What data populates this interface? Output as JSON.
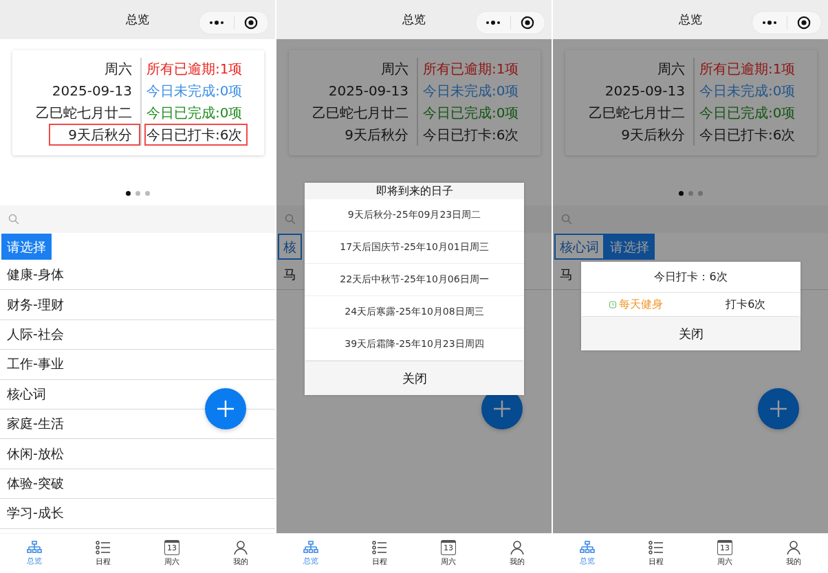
{
  "screens": [
    {
      "nav_title": "总览",
      "dimmed": false,
      "summary": {
        "left": [
          {
            "text": "周六",
            "highlighted": false
          },
          {
            "text": "2025-09-13",
            "highlighted": false
          },
          {
            "text": "乙巳蛇七月廿二",
            "highlighted": false
          },
          {
            "text": "9天后秋分",
            "highlighted": true
          }
        ],
        "right": [
          {
            "text": "所有已逾期:1项",
            "color": "#e8231e",
            "highlighted": false
          },
          {
            "text": "今日未完成:0项",
            "color": "#3a8ee6",
            "highlighted": false
          },
          {
            "text": "今日已完成:0项",
            "color": "#1e8c1e",
            "highlighted": false
          },
          {
            "text": "今日已打卡:6次",
            "color": "#222222",
            "highlighted": true
          }
        ]
      },
      "pager": [
        {
          "selected": true
        },
        {
          "selected": false
        },
        {
          "selected": false
        }
      ],
      "chips": [
        {
          "label": "请选择",
          "selected": true
        }
      ],
      "list": [
        "健康-身体",
        "财务-理财",
        "人际-社会",
        "工作-事业",
        "核心词",
        "家庭-生活",
        "休闲-放松",
        "体验-突破",
        "学习-成长"
      ],
      "tabs": [
        {
          "kind": "tree",
          "label": "总览",
          "selected": true
        },
        {
          "kind": "list",
          "label": "日程",
          "selected": false
        },
        {
          "kind": "calendar",
          "label": "周六",
          "day": "13",
          "selected": false
        },
        {
          "kind": "person",
          "label": "我的",
          "selected": false
        }
      ]
    },
    {
      "nav_title": "总览",
      "dimmed": true,
      "summary": {
        "left": [
          {
            "text": "周六",
            "highlighted": false
          },
          {
            "text": "2025-09-13",
            "highlighted": false
          },
          {
            "text": "乙巳蛇七月廿二",
            "highlighted": false
          },
          {
            "text": "9天后秋分",
            "highlighted": false
          }
        ],
        "right": [
          {
            "text": "所有已逾期:1项",
            "color": "#8b1512",
            "highlighted": false
          },
          {
            "text": "今日未完成:0项",
            "color": "#23558a",
            "highlighted": false
          },
          {
            "text": "今日已完成:0项",
            "color": "#125412",
            "highlighted": false
          },
          {
            "text": "今日已打卡:6次",
            "color": "#141414",
            "highlighted": false
          }
        ]
      },
      "chips": [
        {
          "label": "核",
          "selected": false
        }
      ],
      "list": [
        "马"
      ],
      "dialog": {
        "kind": "upcoming",
        "title": "即将到来的日子",
        "items": [
          "9天后秋分-25年09月23日周二",
          "17天后国庆节-25年10月01日周三",
          "22天后中秋节-25年10月06日周一",
          "24天后寒露-25年10月08日周三",
          "39天后霜降-25年10月23日周四"
        ],
        "close": "关闭"
      },
      "tabs": [
        {
          "kind": "tree",
          "label": "总览",
          "selected": true
        },
        {
          "kind": "list",
          "label": "日程",
          "selected": false
        },
        {
          "kind": "calendar",
          "label": "周六",
          "day": "13",
          "selected": false
        },
        {
          "kind": "person",
          "label": "我的",
          "selected": false
        }
      ]
    },
    {
      "nav_title": "总览",
      "dimmed": true,
      "summary": {
        "left": [
          {
            "text": "周六",
            "highlighted": false
          },
          {
            "text": "2025-09-13",
            "highlighted": false
          },
          {
            "text": "乙巳蛇七月廿二",
            "highlighted": false
          },
          {
            "text": "9天后秋分",
            "highlighted": false
          }
        ],
        "right": [
          {
            "text": "所有已逾期:1项",
            "color": "#8b1512",
            "highlighted": false
          },
          {
            "text": "今日未完成:0项",
            "color": "#23558a",
            "highlighted": false
          },
          {
            "text": "今日已完成:0项",
            "color": "#125412",
            "highlighted": false
          },
          {
            "text": "今日已打卡:6次",
            "color": "#141414",
            "highlighted": false
          }
        ]
      },
      "pager": [
        {
          "selected": true
        },
        {
          "selected": false
        },
        {
          "selected": false
        }
      ],
      "chips": [
        {
          "label": "核心词",
          "selected": false
        },
        {
          "label": "请选择",
          "selected": true
        }
      ],
      "list": [
        "马"
      ],
      "dialog": {
        "kind": "checkin",
        "title": "今日打卡：6次",
        "rows": [
          {
            "name": "每天健身",
            "count": "打卡6次"
          }
        ],
        "close": "关闭"
      },
      "tabs": [
        {
          "kind": "tree",
          "label": "总览",
          "selected": true
        },
        {
          "kind": "list",
          "label": "日程",
          "selected": false
        },
        {
          "kind": "calendar",
          "label": "周六",
          "day": "13",
          "selected": false
        },
        {
          "kind": "person",
          "label": "我的",
          "selected": false
        }
      ]
    }
  ]
}
